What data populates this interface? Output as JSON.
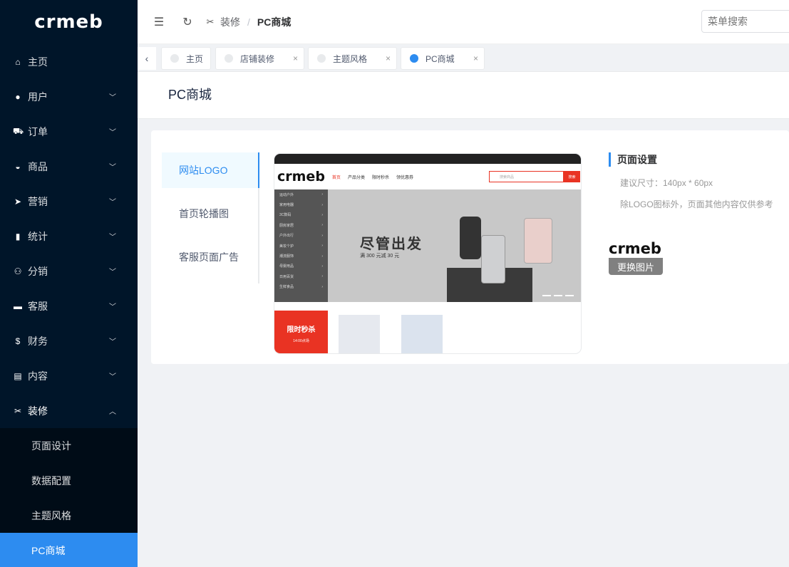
{
  "sidebar": {
    "logo": "crmeb",
    "menu": [
      {
        "label": "主页",
        "icon": "home-icon",
        "glyph": "⌂",
        "has_children": false
      },
      {
        "label": "用户",
        "icon": "user-icon",
        "glyph": "●",
        "has_children": true
      },
      {
        "label": "订单",
        "icon": "cart-icon",
        "glyph": "⛟",
        "has_children": true
      },
      {
        "label": "商品",
        "icon": "basket-icon",
        "glyph": "◒",
        "has_children": true
      },
      {
        "label": "营销",
        "icon": "send-icon",
        "glyph": "➤",
        "has_children": true
      },
      {
        "label": "统计",
        "icon": "stats-icon",
        "glyph": "▮",
        "has_children": true
      },
      {
        "label": "分销",
        "icon": "people-icon",
        "glyph": "⚇",
        "has_children": true
      },
      {
        "label": "客服",
        "icon": "chat-icon",
        "glyph": "▬",
        "has_children": true
      },
      {
        "label": "财务",
        "icon": "dollar-icon",
        "glyph": "$",
        "has_children": true
      },
      {
        "label": "内容",
        "icon": "book-icon",
        "glyph": "▤",
        "has_children": true
      },
      {
        "label": "装修",
        "icon": "tools-icon",
        "glyph": "✂",
        "has_children": true,
        "open": true
      }
    ],
    "submenu": [
      {
        "label": "页面设计",
        "active": false
      },
      {
        "label": "数据配置",
        "active": false
      },
      {
        "label": "主题风格",
        "active": false
      },
      {
        "label": "PC商城",
        "active": true
      }
    ]
  },
  "header": {
    "breadcrumb_parent": "装修",
    "breadcrumb_sep": "/",
    "breadcrumb_current": "PC商城",
    "search_placeholder": "菜单搜索"
  },
  "tabs": [
    {
      "label": "主页",
      "closable": false,
      "active": false
    },
    {
      "label": "店铺装修",
      "closable": true,
      "active": false
    },
    {
      "label": "主题风格",
      "closable": true,
      "active": false
    },
    {
      "label": "PC商城",
      "closable": true,
      "active": true
    }
  ],
  "page": {
    "title": "PC商城"
  },
  "left_menu": [
    {
      "label": "网站LOGO",
      "active": true
    },
    {
      "label": "首页轮播图",
      "active": false
    },
    {
      "label": "客服页面广告",
      "active": false
    }
  ],
  "preview": {
    "logo": "crmeb",
    "nav_links": [
      "首页",
      "产品分类",
      "限时秒杀",
      "领优惠券"
    ],
    "search_placeholder": "搜索商品",
    "search_button": "搜索",
    "categories": [
      "运动户外",
      "家用电器",
      "3C数码",
      "厨房家居",
      "户外出行",
      "美妆个护",
      "潮流服饰",
      "母婴用品",
      "日用百货",
      "生鲜食品"
    ],
    "slogan": "尽管出发",
    "promo": "满 300 元减 30 元",
    "flash_sale_title": "限时秒杀",
    "flash_sale_time": "14:00点场"
  },
  "settings": {
    "title": "页面设置",
    "size_tip": "建议尺寸：140px * 60px",
    "note": "除LOGO图标外，页面其他内容仅供参考",
    "logo_text": "crmeb",
    "change_button": "更换图片"
  },
  "colors": {
    "sidebar_bg": "#001529",
    "accent": "#2d8cf0",
    "preview_red": "#e93323"
  }
}
